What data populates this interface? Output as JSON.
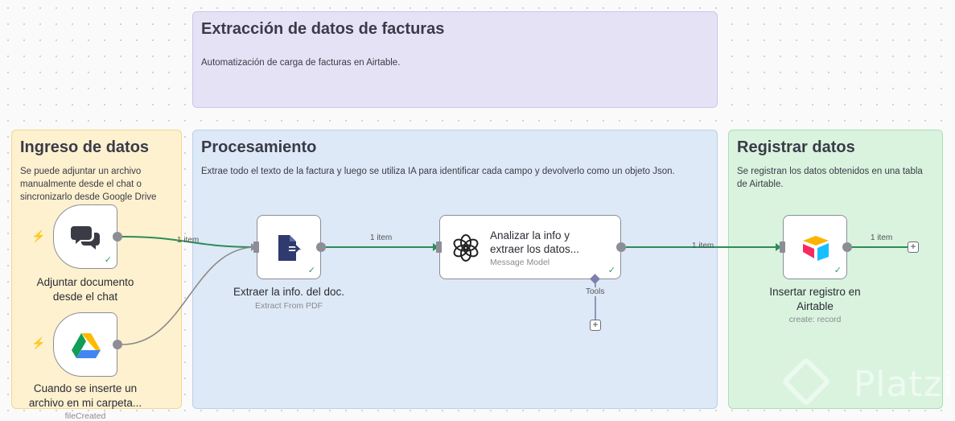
{
  "notes": {
    "title": {
      "heading": "Extracción de datos de facturas",
      "text": "Automatización de carga de facturas en Airtable."
    },
    "ingreso": {
      "heading": "Ingreso de datos",
      "text": "Se puede adjuntar un archivo manualmente desde el chat o sincronizarlo desde Google Drive"
    },
    "procesamiento": {
      "heading": "Procesamiento",
      "text": "Extrae todo el texto de la factura y luego se utiliza IA para identificar cada campo y devolverlo como un objeto Json."
    },
    "registrar": {
      "heading": "Registrar datos",
      "text": "Se registran los datos obtenidos en una tabla de Airtable."
    }
  },
  "nodes": {
    "chat": {
      "label": "Adjuntar documento desde el chat"
    },
    "drive": {
      "label": "Cuando se inserte un archivo en mi carpeta...",
      "sublabel": "fileCreated"
    },
    "pdf": {
      "label": "Extraer la info. del doc.",
      "sublabel": "Extract From PDF"
    },
    "ai": {
      "label": "Analizar la info y extraer los datos...",
      "sublabel": "Message Model",
      "tools_label": "Tools"
    },
    "airtable": {
      "label": "Insertar registro en Airtable",
      "sublabel": "create: record"
    }
  },
  "edges": {
    "chat_pdf": "1 item",
    "pdf_ai": "1 item",
    "ai_airtable": "1 item",
    "airtable_out": "1 item"
  },
  "status": {
    "check": "✓",
    "bolt": "⚡",
    "plus": "+"
  },
  "watermark": "Platzi",
  "colors": {
    "accent_green": "#29a35a",
    "edge_gray": "#8d8d96",
    "trigger_bolt": "#ee6f57"
  }
}
